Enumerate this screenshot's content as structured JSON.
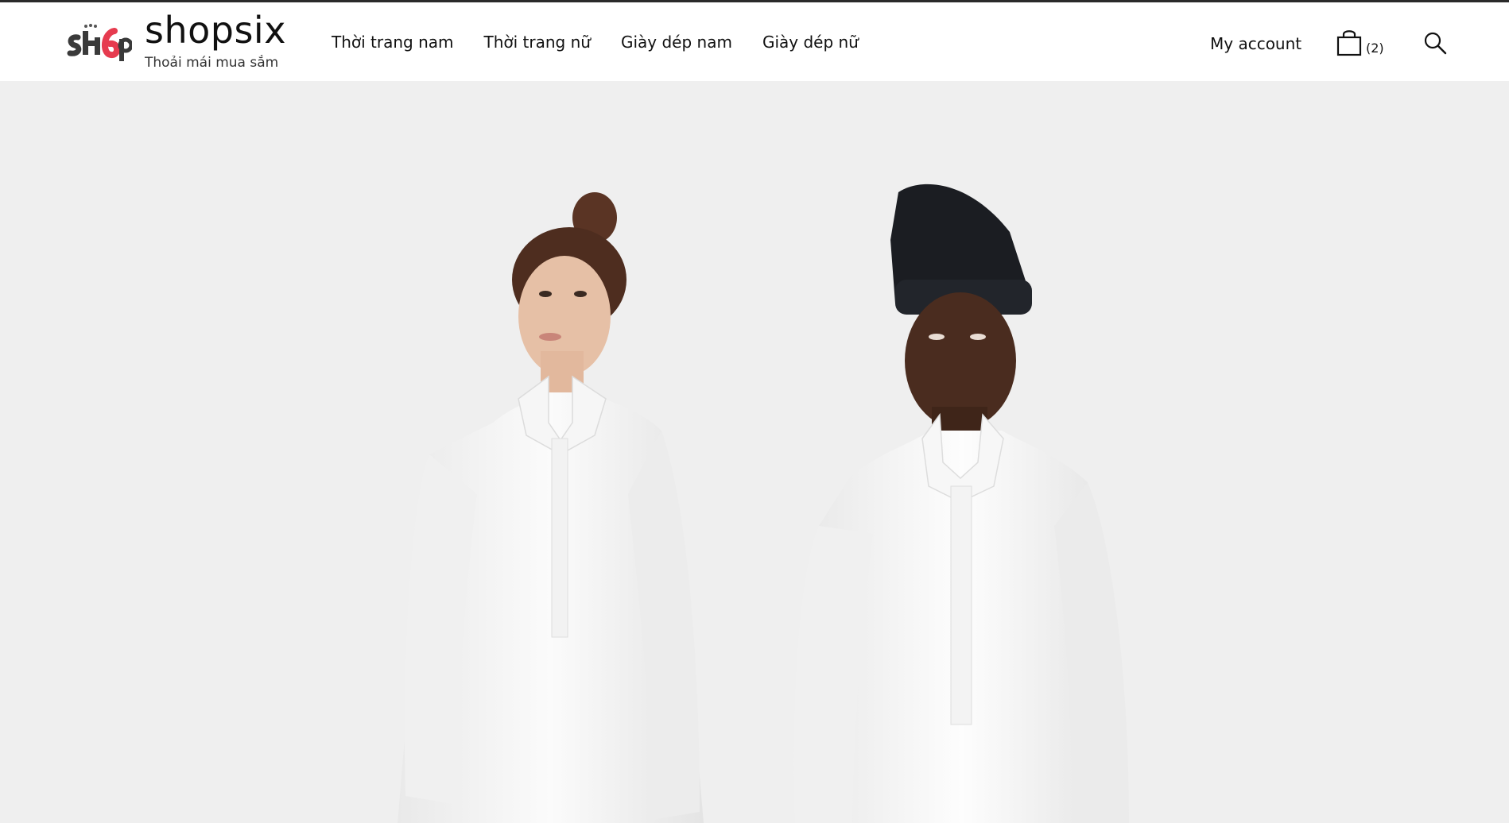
{
  "brand": {
    "logo_text": "sh6p",
    "name": "shopsix",
    "tagline": "Thoải mái mua sắm"
  },
  "nav": {
    "items": [
      {
        "label": "Thời trang nam"
      },
      {
        "label": "Thời trang nữ"
      },
      {
        "label": "Giày dép nam"
      },
      {
        "label": "Giày dép nữ"
      }
    ]
  },
  "account": {
    "label": "My account"
  },
  "cart": {
    "count": "(2)",
    "icon": "shopping-bag-icon"
  },
  "search": {
    "icon": "search-icon"
  },
  "hero": {
    "image": "two models in white shirts on light grey background"
  },
  "colors": {
    "topline": "#2a2a2a",
    "logo_accent": "#e63b4f",
    "hero_bg": "#efefef"
  }
}
